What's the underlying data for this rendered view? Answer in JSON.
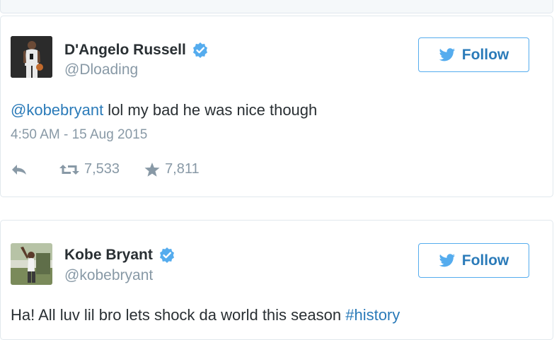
{
  "tweets": [
    {
      "name": "D'Angelo Russell",
      "handle": "@Dloading",
      "follow_label": "Follow",
      "mention": "@kobebryant",
      "text": " lol my bad he was nice though",
      "timestamp": "4:50 AM - 15 Aug 2015",
      "retweets": "7,533",
      "likes": "7,811"
    },
    {
      "name": "Kobe Bryant",
      "handle": "@kobebryant",
      "follow_label": "Follow",
      "text": "Ha! All luv lil bro lets shock da world this season ",
      "hashtag": "#history"
    }
  ],
  "icons": [
    "verified-badge-icon",
    "twitter-bird-icon",
    "reply-icon",
    "retweet-icon",
    "star-icon"
  ],
  "colors": {
    "link": "#2b7bb9",
    "muted": "#8899a6",
    "verified": "#55acee",
    "border": "#e1e8ed"
  }
}
